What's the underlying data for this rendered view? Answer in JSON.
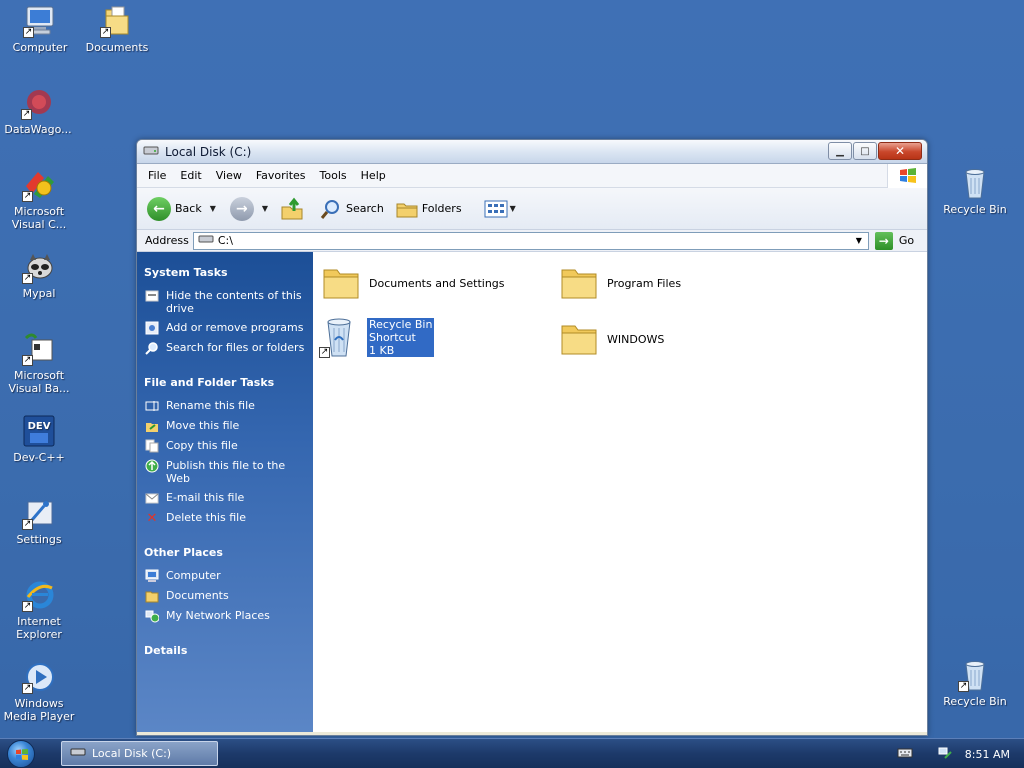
{
  "desktop": {
    "left_icons": [
      {
        "label": "Computer"
      },
      {
        "label": "Documents"
      },
      {
        "label": "DataWago..."
      },
      {
        "label": "Microsoft Visual C..."
      },
      {
        "label": "Mypal"
      },
      {
        "label": "Microsoft Visual Ba..."
      },
      {
        "label": "Dev-C++"
      },
      {
        "label": "Settings"
      },
      {
        "label": "Internet Explorer"
      },
      {
        "label": "Windows Media Player"
      }
    ],
    "right_icons": [
      {
        "label": "Recycle Bin"
      },
      {
        "label": "Recycle Bin"
      }
    ]
  },
  "window": {
    "title": "Local Disk (C:)",
    "menu": [
      "File",
      "Edit",
      "View",
      "Favorites",
      "Tools",
      "Help"
    ],
    "toolbar": {
      "back": "Back",
      "search": "Search",
      "folders": "Folders"
    },
    "address": {
      "label": "Address",
      "value": "C:\\",
      "go": "Go"
    },
    "taskpane": {
      "system_tasks": {
        "heading": "System Tasks",
        "items": [
          "Hide the contents of this drive",
          "Add or remove programs",
          "Search for files or folders"
        ]
      },
      "file_folder_tasks": {
        "heading": "File and Folder Tasks",
        "items": [
          "Rename this file",
          "Move this file",
          "Copy this file",
          "Publish this file to the Web",
          "E-mail this file",
          "Delete this file"
        ]
      },
      "other_places": {
        "heading": "Other Places",
        "items": [
          "Computer",
          "Documents",
          "My Network Places"
        ]
      },
      "details": {
        "heading": "Details"
      }
    },
    "files": [
      {
        "name": "Documents and Settings"
      },
      {
        "name": "Program Files"
      },
      {
        "name": "Recycle Bin",
        "line2": "Shortcut",
        "line3": "1 KB"
      },
      {
        "name": "WINDOWS"
      }
    ]
  },
  "taskbar": {
    "task": "Local Disk (C:)",
    "clock": "8:51 AM"
  },
  "colors": {
    "desktop": "#3b6cae",
    "taskpane": "#1c4f97",
    "selection": "#316ac5"
  }
}
